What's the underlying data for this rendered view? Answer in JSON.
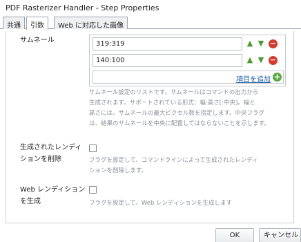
{
  "window": {
    "title": "PDF Rasterizer Handler - Step Properties"
  },
  "tabs": [
    {
      "label": "共通",
      "active": false
    },
    {
      "label": "引数",
      "active": true
    },
    {
      "label": "Web に対応した画像",
      "active": false
    }
  ],
  "thumbnails": {
    "label": "サムネール",
    "items": [
      "319:319",
      "140:100"
    ],
    "add_label": "項目を追加",
    "description_lines": [
      "サムネール設定のリストです。サムネールはコマンドの出力から",
      "生成されます。サポートされている形式：幅:高さ[:中央]。幅と",
      "高さには、サムネールの最大ピクセル数を指定します。中央フラグ",
      "は、結果のサムネールを中央に配置してはならないことを示します。"
    ]
  },
  "delete_generated": {
    "label_lines": [
      "生成されたレンディ",
      "ションを削除"
    ],
    "checked": false,
    "description_lines": [
      "フラグを設定して、コマンドラインによって生成されたレンディ",
      "ションを削除します。"
    ]
  },
  "web_rendition": {
    "label_lines": [
      "Web レンディション",
      "を生成"
    ],
    "checked": false,
    "description_lines": [
      "フラグを設定して、Web レンディションを生成します"
    ]
  },
  "footer": {
    "ok_label": "OK",
    "cancel_label": "キャンセル"
  },
  "colors": {
    "accent_link": "#1e5ea8",
    "add_green": "#58a73b",
    "delete_red": "#d23b2e",
    "arrow_green": "#4a9b2f"
  },
  "icons": {
    "move_up": "arrow-up-icon",
    "move_down": "arrow-down-icon",
    "remove": "remove-icon",
    "add": "add-icon"
  }
}
